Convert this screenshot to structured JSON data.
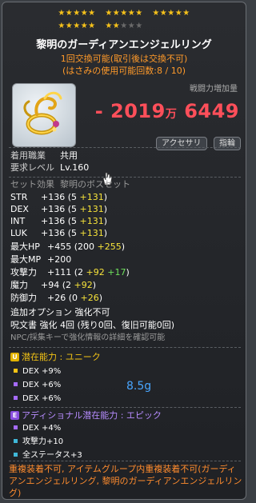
{
  "stars": {
    "row1": [
      "★★★★★",
      "★★★★★",
      "★★★★★"
    ],
    "row2_lit": [
      "★★★★★",
      "★★"
    ],
    "row2_dim": "★★★"
  },
  "title": "黎明のガーディアンエンジェルリング",
  "trade_info": "1回交換可能(取引後は交換不可)",
  "scissors_info": "(はさみの使用可能回数:8 / 10)",
  "damage": {
    "label": "戦闘力増加量",
    "value_main": "- 2019",
    "value_unit": "万",
    "value_rest": "6449"
  },
  "tags": [
    "アクセサリ",
    "指輪"
  ],
  "requirements": {
    "job_label": "着用職業",
    "job_value": "共用",
    "level_label": "要求レベル",
    "level_value": "Lv.160"
  },
  "set_effect": {
    "label": "セット効果",
    "value": "黎明のボスセット"
  },
  "stats": [
    {
      "name": "STR",
      "total": "+136",
      "base": "5",
      "bonus": "+131"
    },
    {
      "name": "DEX",
      "total": "+136",
      "base": "5",
      "bonus": "+131"
    },
    {
      "name": "INT",
      "total": "+136",
      "base": "5",
      "bonus": "+131"
    },
    {
      "name": "LUK",
      "total": "+136",
      "base": "5",
      "bonus": "+131"
    }
  ],
  "stats2": {
    "hp": {
      "name": "最大HP",
      "total": "+455",
      "base": "200",
      "bonus": "+255"
    },
    "mp": {
      "name": "最大MP",
      "total": "+200"
    },
    "atk": {
      "name": "攻撃力",
      "total": "+111",
      "base": "2",
      "bonus": "+92",
      "bonus2": "+17"
    },
    "matk": {
      "name": "魔力",
      "total": "+94",
      "base": "2",
      "bonus": "+92"
    },
    "def": {
      "name": "防御力",
      "total": "+26",
      "base": "0",
      "bonus": "+26"
    }
  },
  "extra": {
    "option": "追加オプション 強化不可",
    "scroll": "呪文書 強化 4回 (残り0回、復旧可能0回)",
    "npc": "NPC/採集キーで強化情報の詳細を確認可能"
  },
  "potential": {
    "badge": "U",
    "label": "潜在能力 : ユニーク",
    "lines": [
      "DEX +9%",
      "DEX +6%",
      "DEX +6%"
    ],
    "color": "#f3c315"
  },
  "annotation": "8.5g",
  "additional": {
    "badge": "E",
    "label": "アディショナル潜在能力 : エピック",
    "lines": [
      "DEX +4%",
      "攻撃力+10",
      "全ステータス+3"
    ],
    "color": "#a56bff"
  },
  "footer": "重複装着不可, アイテムグループ内重複装着不可(ガーディアンエンジェルリング, 黎明のガーディアンエンジェルリング)"
}
